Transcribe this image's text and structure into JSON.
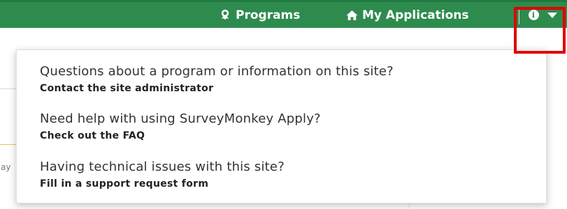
{
  "navbar": {
    "programs_label": "Programs",
    "programs_icon": "award-icon",
    "my_applications_label": "My Applications",
    "my_applications_icon": "home-icon",
    "info_icon": "info-icon",
    "caret_icon": "caret-down-icon",
    "info_glyph": "i",
    "brand_color": "#2e8b4e"
  },
  "help_menu": {
    "items": [
      {
        "question": "Questions about a program or information on this site?",
        "link": "Contact the site administrator"
      },
      {
        "question": "Need help with using SurveyMonkey Apply?",
        "link": "Check out the FAQ"
      },
      {
        "question": "Having technical issues with this site?",
        "link": "Fill in a support request form"
      }
    ]
  },
  "background": {
    "fragment": "ay"
  },
  "highlight_color": "#e00000"
}
